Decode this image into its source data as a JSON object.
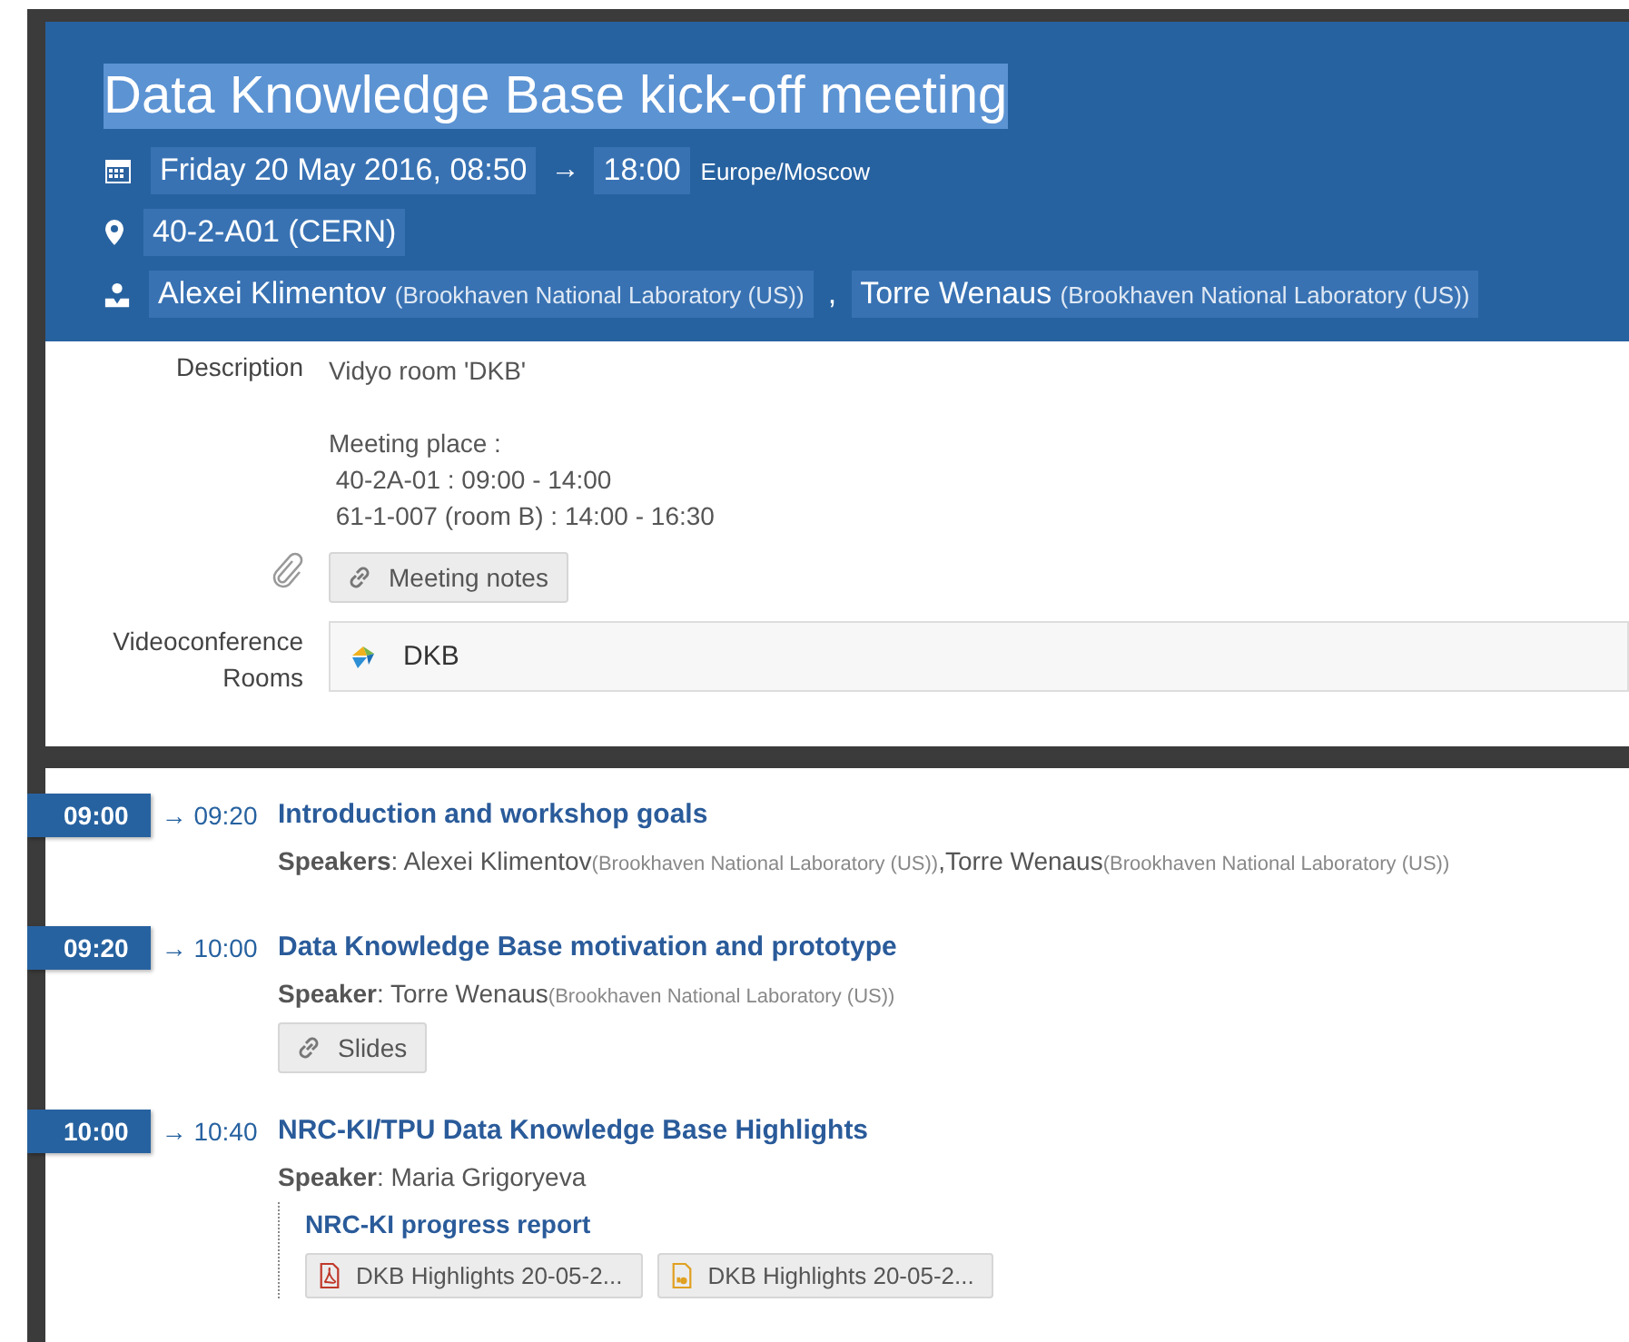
{
  "event": {
    "title": "Data Knowledge Base kick-off meeting",
    "date": "Friday 20 May 2016, 08:50",
    "arrow": "→",
    "end_time": "18:00",
    "timezone": "Europe/Moscow",
    "location": "40-2-A01 (CERN)",
    "chairs": [
      {
        "name": "Alexei Klimentov",
        "affiliation": "(Brookhaven National Laboratory (US))"
      },
      {
        "name": "Torre Wenaus",
        "affiliation": "(Brookhaven National Laboratory (US))"
      }
    ],
    "separator": ","
  },
  "details": {
    "description_label": "Description",
    "description_paragraphs": [
      [
        "Vidyo room 'DKB'"
      ],
      [
        "Meeting place :",
        " 40-2A-01 : 09:00 - 14:00",
        " 61-1-007 (room B) : 14:00 - 16:30"
      ]
    ],
    "materials": [
      {
        "kind": "link",
        "label": "Meeting notes"
      }
    ],
    "videoconference_label": "Videoconference Rooms",
    "rooms": [
      "DKB"
    ]
  },
  "timetable": [
    {
      "start": "09:00",
      "end": "→ 09:20",
      "title": "Introduction and workshop goals",
      "speaker_label": "**Speakers**:",
      "speakers": [
        {
          "name": "Alexei Klimentov",
          "affiliation": "(Brookhaven National Laboratory (US))"
        },
        {
          "name": "Torre Wenaus",
          "affiliation": "(Brookhaven National Laboratory (US))"
        }
      ],
      "separator": ","
    },
    {
      "start": "09:20",
      "end": "→ 10:00",
      "title": "Data Knowledge Base motivation and prototype",
      "speaker_label": "**Speaker**:",
      "speakers": [
        {
          "name": "Torre Wenaus",
          "affiliation": "(Brookhaven National Laboratory (US))"
        }
      ],
      "materials": [
        {
          "kind": "link",
          "label": "Slides"
        }
      ]
    },
    {
      "start": "10:00",
      "end": "→ 10:40",
      "title": "NRC-KI/TPU Data Knowledge Base Highlights",
      "speaker_label": "**Speaker**:",
      "speakers": [
        {
          "name": "Maria Grigoryeva"
        }
      ],
      "subcontributions": [
        {
          "title": "NRC-KI progress report",
          "materials": [
            {
              "kind": "pdf",
              "label": "DKB Highlights 20-05-2..."
            },
            {
              "kind": "presentation",
              "label": "DKB Highlights 20-05-2..."
            }
          ]
        }
      ]
    }
  ]
}
